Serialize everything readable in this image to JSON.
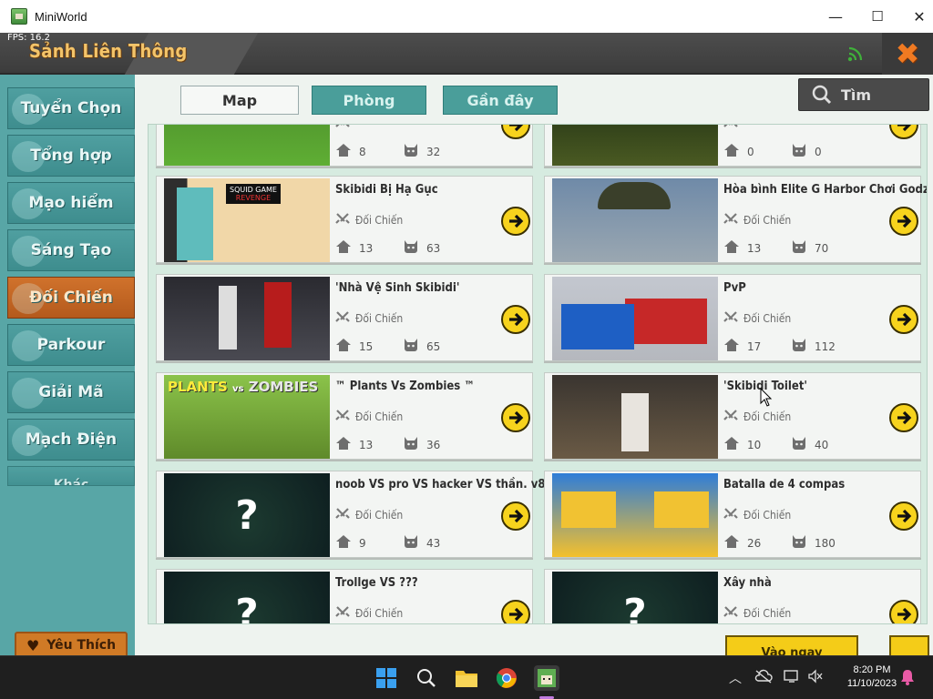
{
  "window": {
    "title": "MiniWorld",
    "minimize": "—",
    "maximize": "☐",
    "close": "✕"
  },
  "hud": {
    "fps": "FPS: 16.2",
    "lobby_title": "Sảnh Liên Thông",
    "close_glyph": "✖"
  },
  "sidebar": {
    "items": [
      {
        "label": "Tuyển Chọn"
      },
      {
        "label": "Tổng hợp"
      },
      {
        "label": "Mạo hiểm"
      },
      {
        "label": "Sáng Tạo"
      },
      {
        "label": "Đối Chiến",
        "active": true
      },
      {
        "label": "Parkour"
      },
      {
        "label": "Giải Mã"
      },
      {
        "label": "Mạch Điện"
      },
      {
        "label": "Khác"
      }
    ],
    "favorite_label": "Yêu Thích"
  },
  "tabs": {
    "map": "Map",
    "room": "Phòng",
    "recent": "Gần đây"
  },
  "search": {
    "placeholder": "Tìm"
  },
  "cards": [
    {
      "title": "",
      "mode": "",
      "rooms": "8",
      "players": "32"
    },
    {
      "title": "",
      "mode": "",
      "rooms": "0",
      "players": "0"
    },
    {
      "title": "Skibidi Bị Hạ Gục",
      "mode": "Đối Chiến",
      "rooms": "13",
      "players": "63"
    },
    {
      "title": "Hòa bình Elite G Harbor Chơi Godzilla",
      "mode": "Đối Chiến",
      "rooms": "13",
      "players": "70"
    },
    {
      "title": "'Nhà Vệ Sinh Skibidi'",
      "mode": "Đối Chiến",
      "rooms": "15",
      "players": "65"
    },
    {
      "title": "PvP",
      "mode": "Đối Chiến",
      "rooms": "17",
      "players": "112"
    },
    {
      "title": "™ Plants Vs Zombies ™",
      "mode": "Đối Chiến",
      "rooms": "13",
      "players": "36"
    },
    {
      "title": "'Skibidi Toilet'",
      "mode": "Đối Chiến",
      "rooms": "10",
      "players": "40"
    },
    {
      "title": "noob VS pro VS hacker VS thần. v8",
      "mode": "Đối Chiến",
      "rooms": "9",
      "players": "43"
    },
    {
      "title": "Batalla de 4 compas",
      "mode": "Đối Chiến",
      "rooms": "26",
      "players": "180"
    },
    {
      "title": "Trollge VS ???",
      "mode": "Đối Chiến",
      "rooms": "",
      "players": ""
    },
    {
      "title": "Xây nhà",
      "mode": "Đối Chiến",
      "rooms": "",
      "players": ""
    }
  ],
  "thumb_text": {
    "squid": "SQUID GAME",
    "squid_sub": "REVENGE",
    "pvz_left": "PLANTS",
    "pvz_vs": "vs",
    "pvz_right": "ZOMBIES",
    "unknown": "?"
  },
  "bottom": {
    "join_label": "Vào ngay"
  },
  "taskbar": {
    "time": "8:20 PM",
    "date": "11/10/2023"
  },
  "colors": {
    "accent_orange": "#d0722c",
    "teal": "#4a9e9a",
    "yellow": "#f7d31d"
  }
}
